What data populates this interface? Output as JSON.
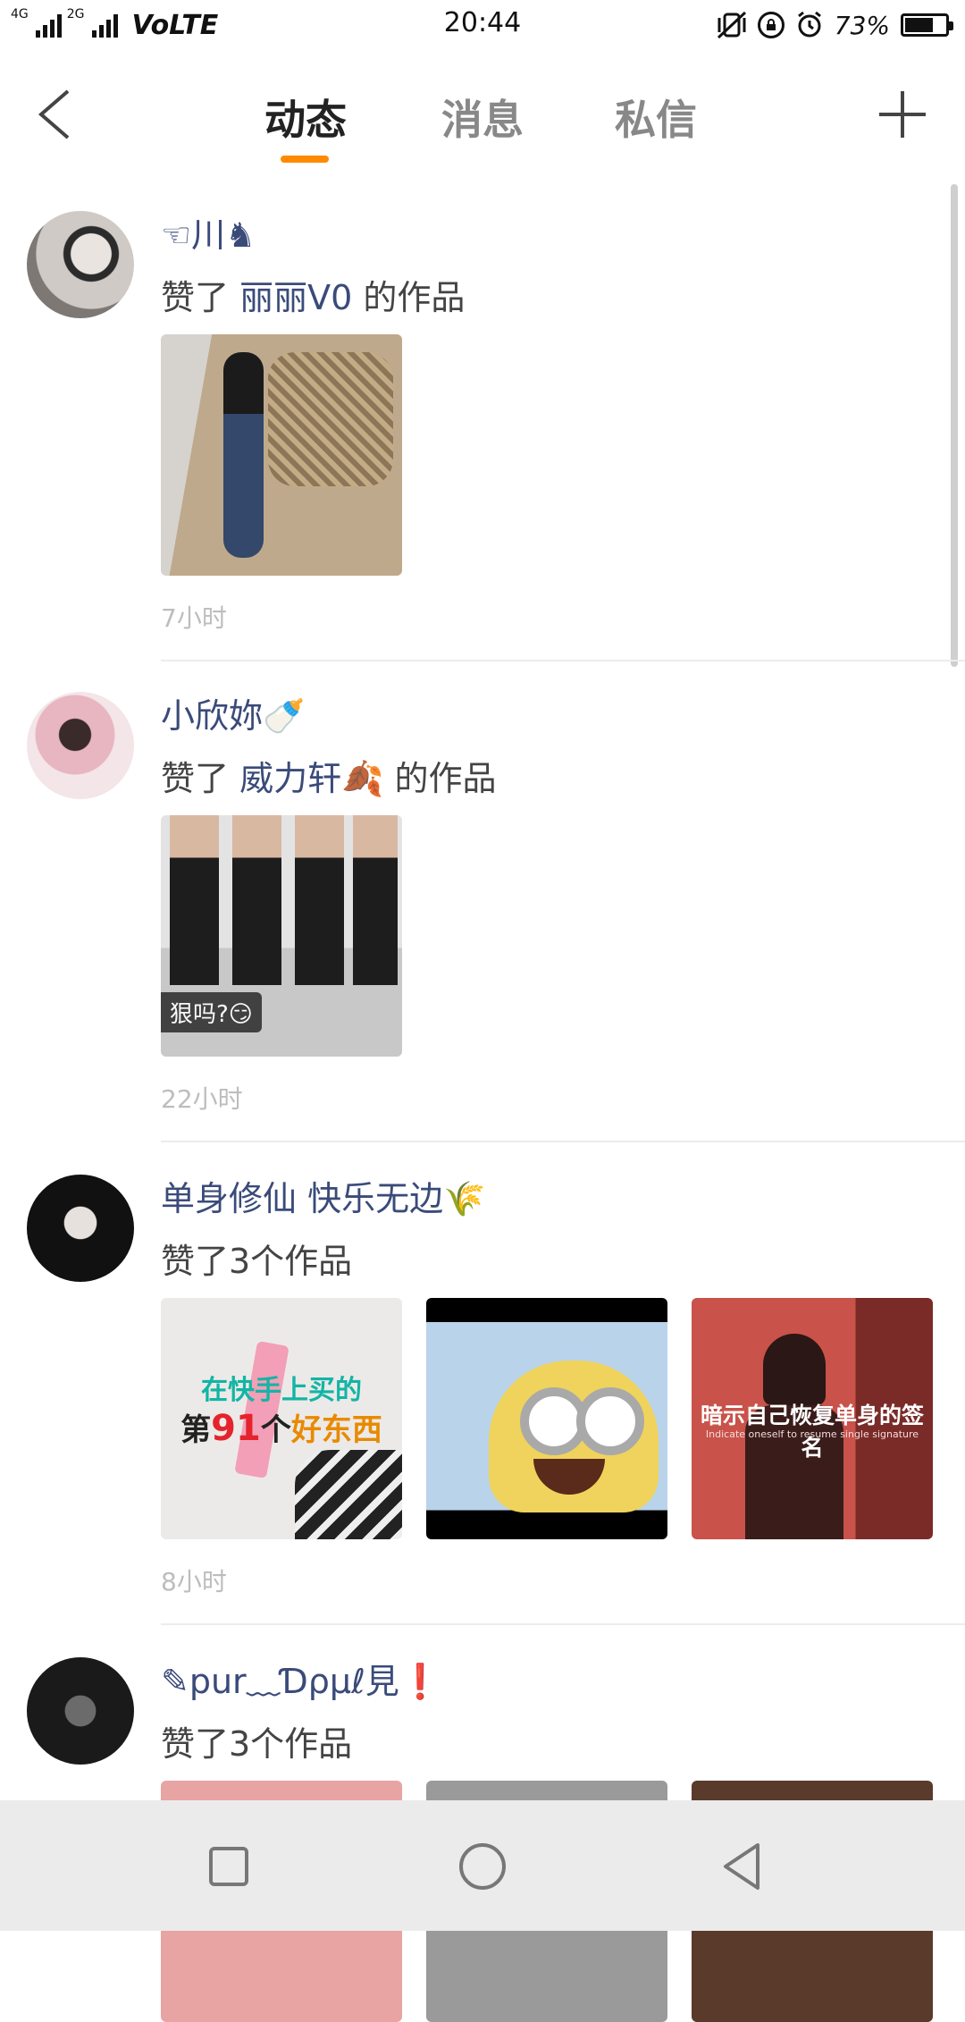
{
  "status_bar": {
    "net_4g": "4G",
    "net_2g": "2G",
    "volte": "VoLTE",
    "time": "20:44",
    "battery_percent_label": "73%",
    "battery_level": 0.73
  },
  "header": {
    "tabs": [
      {
        "label": "动态",
        "active": true
      },
      {
        "label": "消息",
        "active": false
      },
      {
        "label": "私信",
        "active": false
      }
    ],
    "accent_color": "#ff8a00"
  },
  "feed": [
    {
      "username": "☜川♞",
      "action_prefix": "赞了",
      "target_user": "丽丽V0",
      "action_suffix": "的作品",
      "thumbnails": [
        {
          "caption": ""
        }
      ],
      "time": "7小时"
    },
    {
      "username": "小欣妳🍼",
      "action_prefix": "赞了",
      "target_user": "威力轩🍂",
      "action_suffix": "的作品",
      "thumbnails": [
        {
          "caption": "狠吗?😏"
        }
      ],
      "time": "22小时"
    },
    {
      "username": "单身修仙 快乐无边🌾",
      "action_prefix": "赞了3个作品",
      "target_user": "",
      "action_suffix": "",
      "thumbnails": [
        {
          "caption_line1": "在快手上买的",
          "caption_line2_a": "第",
          "caption_line2_num": "91",
          "caption_line2_b": "个",
          "caption_line2_c": "好东西"
        },
        {
          "caption": ""
        },
        {
          "caption": "暗示自己恢复单身的签名",
          "sub_caption": "Indicate oneself to resume single signature"
        }
      ],
      "time": "8小时"
    },
    {
      "username": "✎pur﹏Ɗρμℓ見❗",
      "action_prefix": "赞了3个作品",
      "target_user": "",
      "action_suffix": "",
      "thumbnails": [],
      "time": ""
    }
  ]
}
